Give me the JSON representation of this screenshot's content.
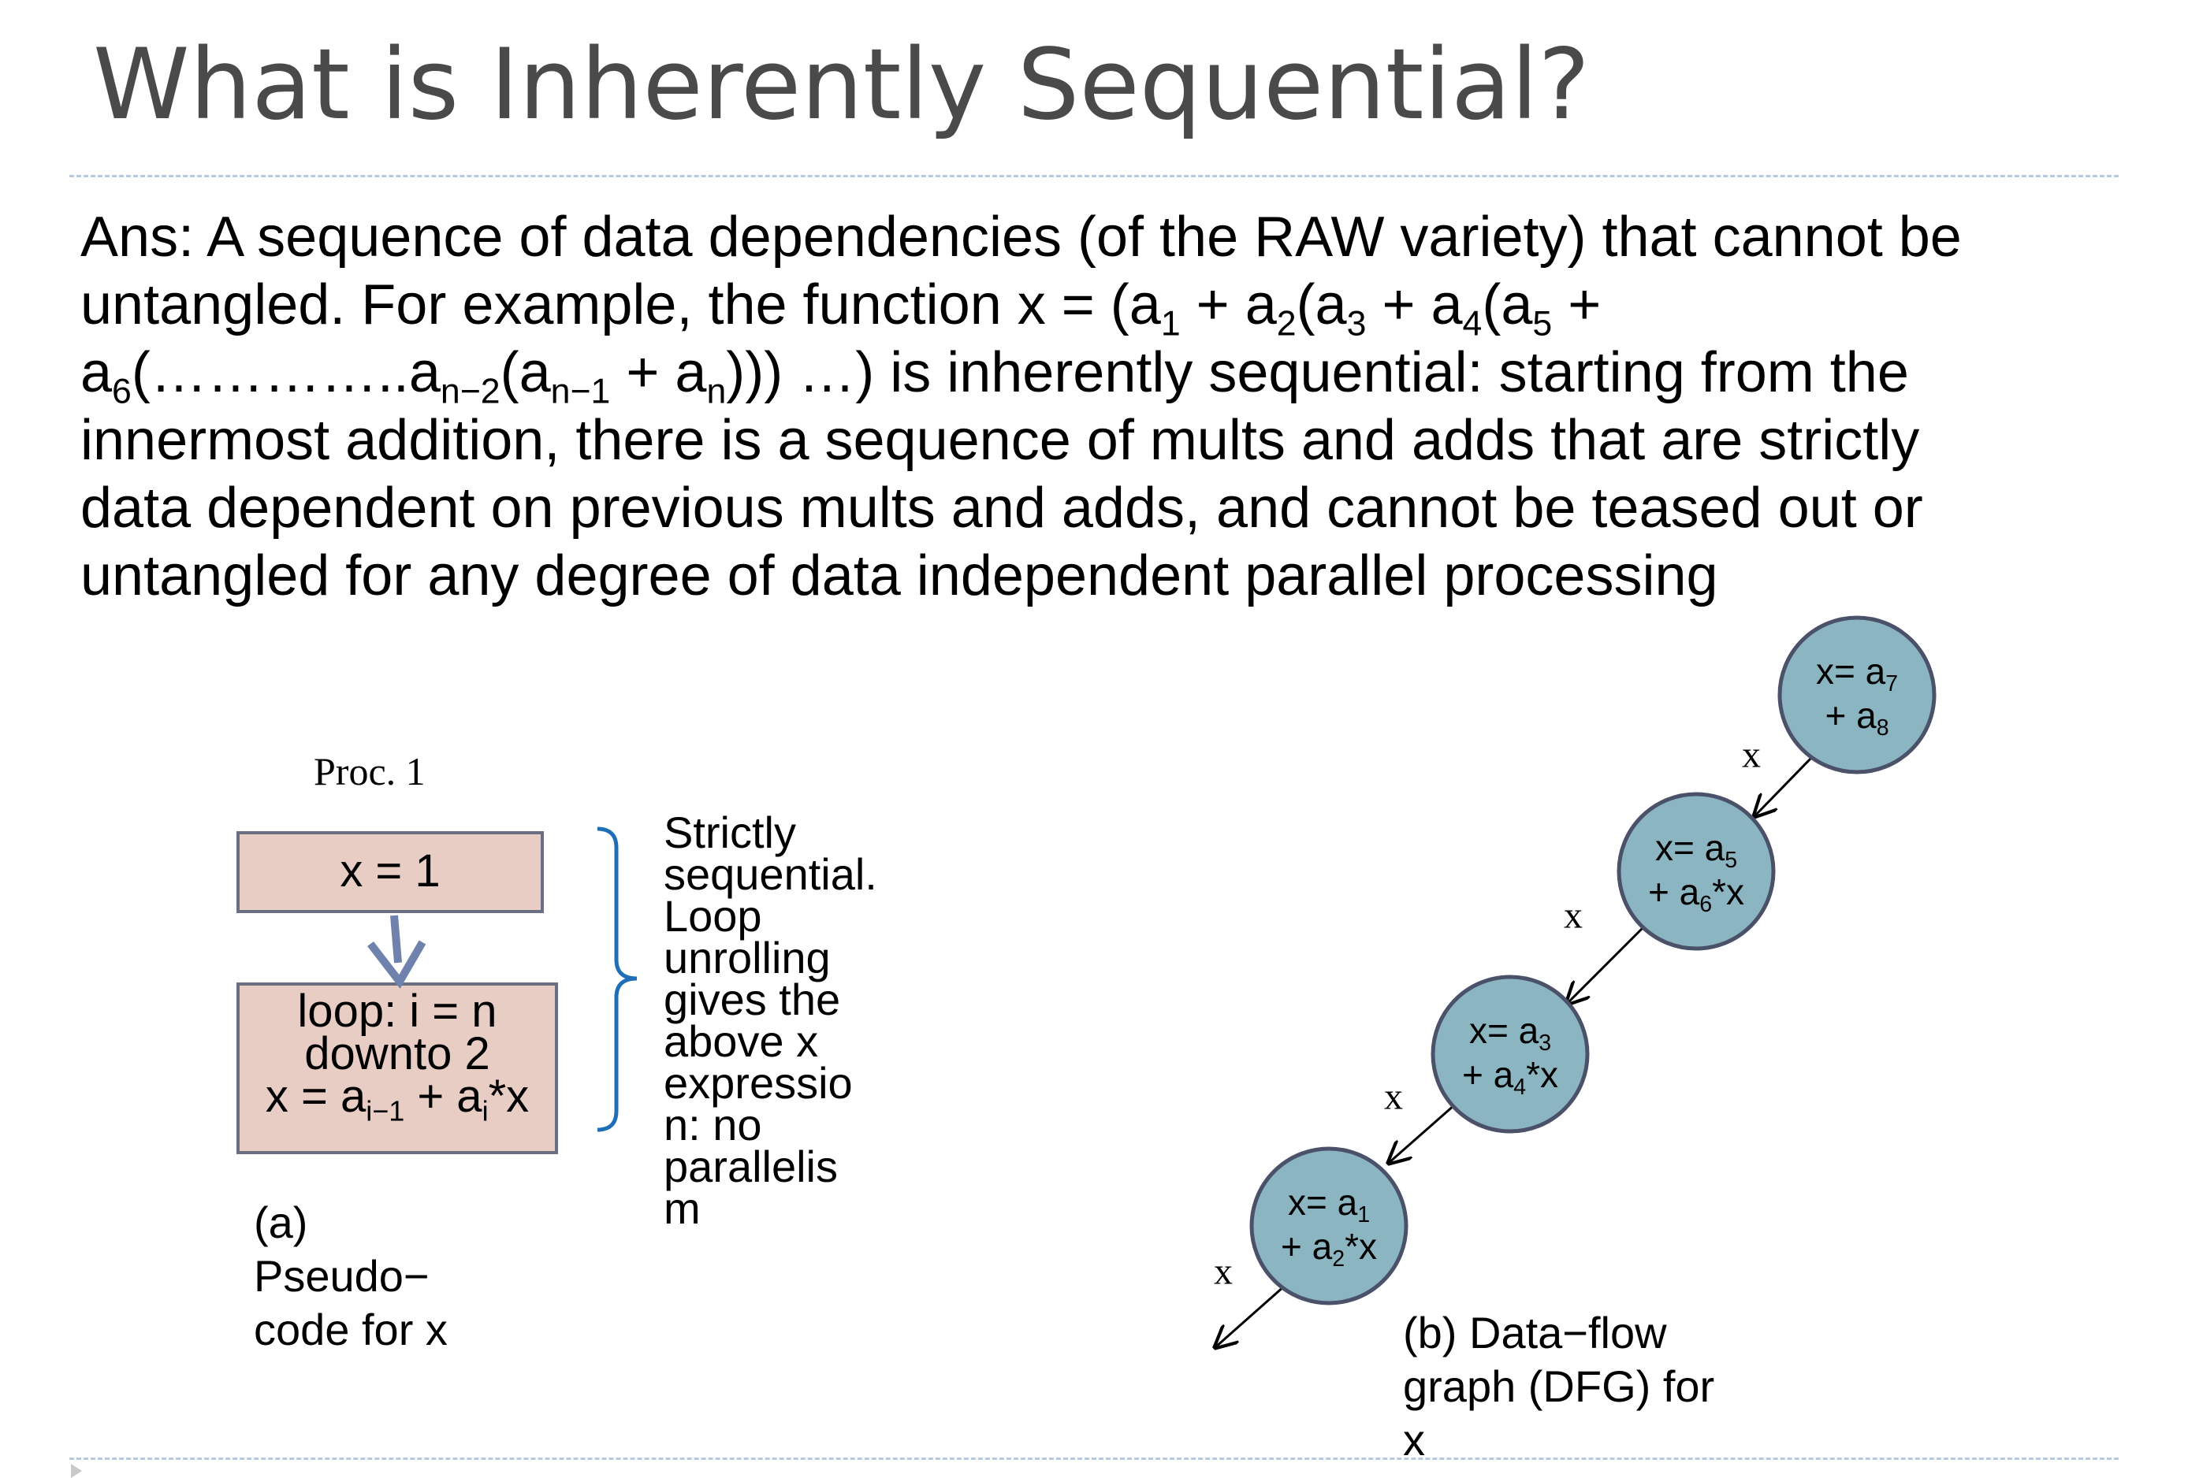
{
  "title": "What is Inherently Sequential?",
  "body_lines": [
    "Ans:  A sequence of data dependencies (of the RAW variety) that cannot be",
    "untangled. For example, the function x = (a<sub>1</sub> + a<sub>2</sub>(a<sub>3</sub> + a<sub>4</sub>(a<sub>5</sub> +",
    "a<sub>6</sub>(…………..a<sub>n−2</sub>(a<sub>n−1</sub> + a<sub>n</sub>))) …) is inherently sequential:  starting from the",
    "innermost addition, there is a  sequence of mults and adds that are strictly",
    "data dependent on previous mults and adds, and cannot be teased out or",
    "untangled for any degree of data independent parallel processing"
  ],
  "pseudocode": {
    "proc_label": "Proc. 1",
    "init": "x = 1",
    "loop_lines": [
      "loop: i = n",
      "downto 2",
      "x = a<sub>i−1</sub> + a<sub>i</sub>*x"
    ],
    "note_lines": [
      "Strictly",
      "sequential.",
      "Loop",
      "unrolling",
      "gives the",
      "above x",
      "expressio",
      "n: no",
      "parallelis",
      "m"
    ],
    "caption_lines": [
      "(a)",
      "Pseudo−",
      "code for x"
    ]
  },
  "dfg": {
    "nodes": [
      {
        "line1": "x= a<sub>7</sub>",
        "line2": "+ a<sub>8</sub>"
      },
      {
        "line1": "x= a<sub>5</sub>",
        "line2": "+ a<sub>6</sub>*x"
      },
      {
        "line1": "x= a<sub>3</sub>",
        "line2": "+ a<sub>4</sub>*x"
      },
      {
        "line1": "x= a<sub>1</sub>",
        "line2": "+ a<sub>2</sub>*x"
      }
    ],
    "edge_label": "x",
    "caption_lines": [
      "(b) Data−flow",
      "graph (DFG) for",
      "x"
    ]
  },
  "colors": {
    "node_fill": "#8ab5c1",
    "node_stroke": "#4a5168",
    "box_fill": "#e8cdc5",
    "box_stroke": "#6a6f84",
    "brace": "#1f6fb8",
    "flow_arrow": "#6f82ad",
    "title_text": "#4a4a4a"
  }
}
